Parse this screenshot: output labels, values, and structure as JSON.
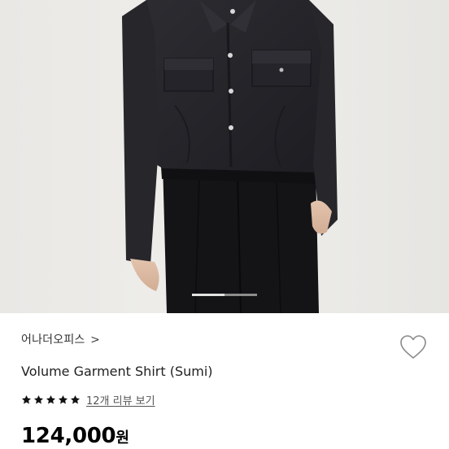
{
  "product": {
    "brand": "어나더오피스",
    "brand_chevron": ">",
    "title": "Volume Garment Shirt (Sumi)",
    "rating_stars": 5,
    "review_count_label": "12개 리뷰 보기",
    "price_value": "124,000",
    "price_unit": "원"
  },
  "gallery": {
    "image_subject": "model-wearing-black-shirt",
    "active_index": 1,
    "total": 2
  },
  "colors": {
    "background": "#ffffff",
    "star": "#111111",
    "text_primary": "#222222",
    "text_secondary": "#555555"
  }
}
